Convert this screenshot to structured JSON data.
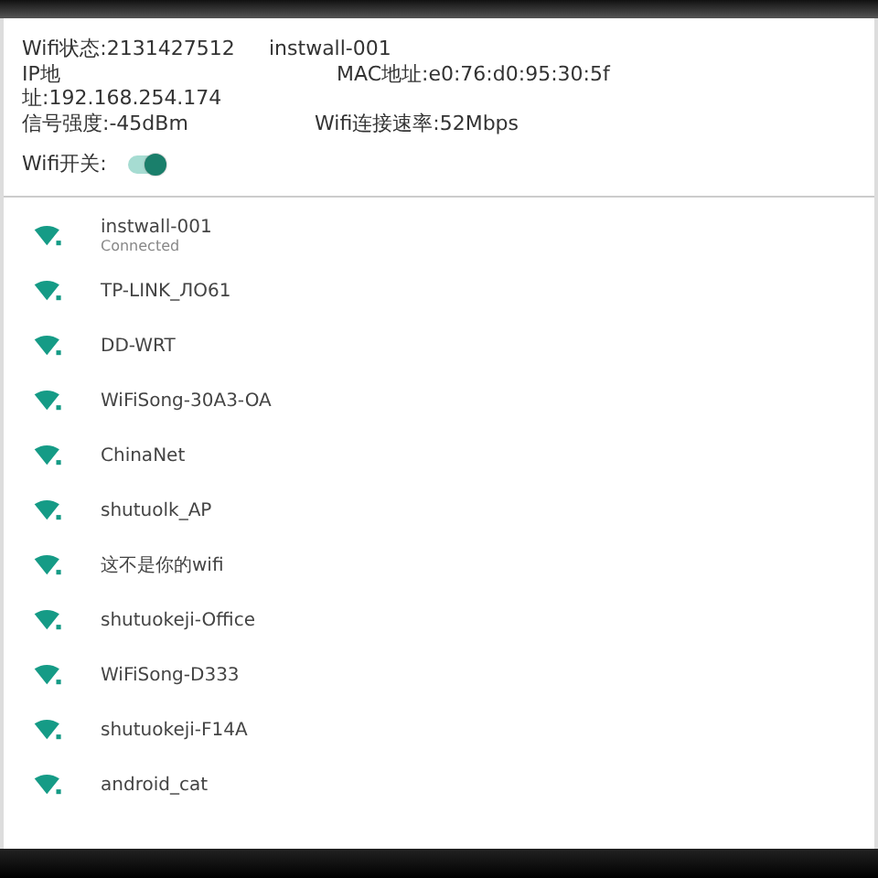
{
  "status": {
    "wifi_state": "Wifi状态:2131427512",
    "ssid": "instwall-001",
    "ip": "IP地址:192.168.254.174",
    "mac": "MAC地址:e0:76:d0:95:30:5f",
    "signal": "信号强度:-45dBm",
    "speed": "Wifi连接速率:52Mbps"
  },
  "wifi_switch": {
    "label": "Wifi开关:",
    "on": true
  },
  "networks": [
    {
      "name": "instwall-001",
      "detail": "Connected"
    },
    {
      "name": "TP-LINK_ЛО61"
    },
    {
      "name": "DD-WRT"
    },
    {
      "name": "WiFiSong-30A3-OA"
    },
    {
      "name": "ChinaNet"
    },
    {
      "name": "shutuolk_AP"
    },
    {
      "name": "这不是你的wifi"
    },
    {
      "name": "shutuokeji-Office"
    },
    {
      "name": "WiFiSong-D333"
    },
    {
      "name": "shutuokeji-F14A"
    },
    {
      "name": "android_cat"
    }
  ]
}
